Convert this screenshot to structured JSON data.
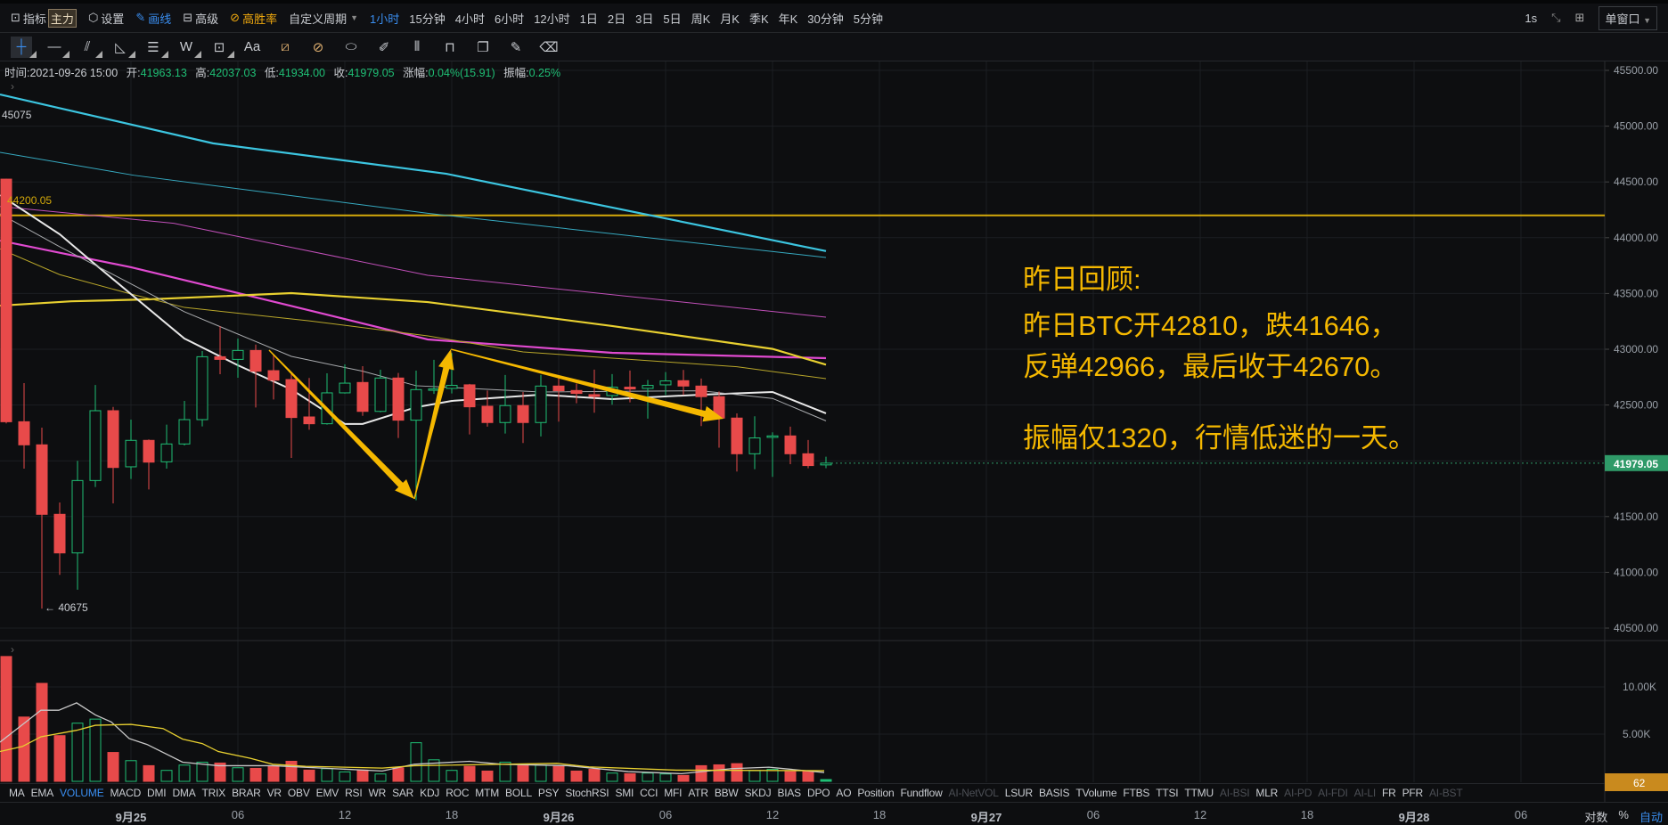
{
  "toolbar": {
    "indicator": "指标",
    "main_tag": "主力",
    "settings": "设置",
    "draw": "画线",
    "advanced": "高级",
    "winrate": "高胜率",
    "custom_period": "自定义周期",
    "periods": [
      "1小时",
      "15分钟",
      "4小时",
      "6小时",
      "12小时",
      "1日",
      "2日",
      "3日",
      "5日",
      "周K",
      "月K",
      "季K",
      "年K",
      "30分钟",
      "5分钟"
    ],
    "active_period": "1小时",
    "refresh": "1s",
    "layout": "单窗口"
  },
  "drawing_tools": [
    "crosshair",
    "horizontal-line",
    "trend-line",
    "triangle",
    "parallel-channel",
    "wave",
    "measure-box",
    "text",
    "fib-tool",
    "gann-tool",
    "ruler",
    "pen",
    "candle-pattern",
    "lock",
    "copy",
    "note",
    "delete"
  ],
  "info": {
    "time_label": "时间:",
    "time": "2021-09-26 15:00",
    "open_label": "开:",
    "open": "41963.13",
    "high_label": "高:",
    "high": "42037.03",
    "low_label": "低:",
    "low": "41934.00",
    "close_label": "收:",
    "close": "41979.05",
    "change_label": "涨幅:",
    "change": "0.04%(15.91)",
    "amp_label": "振幅:",
    "amp": "0.25%"
  },
  "annotation": {
    "title": "昨日回顾:",
    "line1": "昨日BTC开42810，跌41646，",
    "line2": "反弹42966，最后收于42670。",
    "line3": "振幅仅1320，行情低迷的一天。"
  },
  "labels": {
    "max": "45075",
    "min": "← 40675",
    "hline": "44200.05",
    "current_price": "41979.05",
    "volume_badge": "62"
  },
  "indicators": [
    {
      "name": "MA"
    },
    {
      "name": "EMA"
    },
    {
      "name": "VOLUME",
      "active": true
    },
    {
      "name": "MACD"
    },
    {
      "name": "DMI"
    },
    {
      "name": "DMA"
    },
    {
      "name": "TRIX"
    },
    {
      "name": "BRAR"
    },
    {
      "name": "VR"
    },
    {
      "name": "OBV"
    },
    {
      "name": "EMV"
    },
    {
      "name": "RSI"
    },
    {
      "name": "WR"
    },
    {
      "name": "SAR"
    },
    {
      "name": "KDJ"
    },
    {
      "name": "ROC"
    },
    {
      "name": "MTM"
    },
    {
      "name": "BOLL"
    },
    {
      "name": "PSY"
    },
    {
      "name": "StochRSI"
    },
    {
      "name": "SMI"
    },
    {
      "name": "CCI"
    },
    {
      "name": "MFI"
    },
    {
      "name": "ATR"
    },
    {
      "name": "BBW"
    },
    {
      "name": "SKDJ"
    },
    {
      "name": "BIAS"
    },
    {
      "name": "DPO"
    },
    {
      "name": "AO"
    },
    {
      "name": "Position"
    },
    {
      "name": "Fundflow"
    },
    {
      "name": "AI-NetVOL",
      "disabled": true
    },
    {
      "name": "LSUR"
    },
    {
      "name": "BASIS"
    },
    {
      "name": "TVolume"
    },
    {
      "name": "FTBS"
    },
    {
      "name": "TTSI"
    },
    {
      "name": "TTMU"
    },
    {
      "name": "AI-BSI",
      "disabled": true
    },
    {
      "name": "MLR"
    },
    {
      "name": "AI-PD",
      "disabled": true
    },
    {
      "name": "AI-FDI",
      "disabled": true
    },
    {
      "name": "AI-LI",
      "disabled": true
    },
    {
      "name": "FR"
    },
    {
      "name": "PFR"
    },
    {
      "name": "AI-BST",
      "disabled": true
    }
  ],
  "axis_controls": {
    "log": "对数",
    "percent": "%",
    "auto": "自动"
  },
  "chart_data": {
    "type": "candlestick",
    "interval": "1h",
    "colors": {
      "up": "#1fbf75",
      "down": "#e84a4a",
      "hline": "#d4a90a",
      "arrow": "#f5b800",
      "current": "#2f9a68",
      "badge": "#c98a1e"
    },
    "y_ticks": [
      45500,
      45000,
      44500,
      44000,
      43500,
      43000,
      42500,
      42000,
      41500,
      41000,
      40500
    ],
    "y_tick_labels": [
      "45500.00",
      "45000.00",
      "44500.00",
      "44000.00",
      "43500.00",
      "43000.00",
      "42500.00",
      "42000.00",
      "41500.00",
      "41000.00",
      "40500.00"
    ],
    "volume_ticks": [
      {
        "v": 10000,
        "label": "10.00K"
      },
      {
        "v": 5000,
        "label": "5.00K"
      }
    ],
    "x_ticks": [
      {
        "i": 7,
        "label": "9月25",
        "bold": true
      },
      {
        "i": 13,
        "label": "06"
      },
      {
        "i": 19,
        "label": "12"
      },
      {
        "i": 25,
        "label": "18"
      },
      {
        "i": 31,
        "label": "9月26",
        "bold": true
      },
      {
        "i": 37,
        "label": "06"
      },
      {
        "i": 43,
        "label": "12"
      },
      {
        "i": 49,
        "label": "18"
      },
      {
        "i": 55,
        "label": "9月27",
        "bold": true
      },
      {
        "i": 61,
        "label": "06"
      },
      {
        "i": 67,
        "label": "12"
      },
      {
        "i": 73,
        "label": "18"
      },
      {
        "i": 79,
        "label": "9月28",
        "bold": true
      },
      {
        "i": 85,
        "label": "06"
      }
    ],
    "candles_ohlc": [
      [
        44525,
        44530,
        42335,
        42350
      ],
      [
        42350,
        42696,
        41930,
        42143
      ],
      [
        42143,
        42297,
        40675,
        41520
      ],
      [
        41520,
        41626,
        40977,
        41174
      ],
      [
        41174,
        42000,
        40844,
        41823
      ],
      [
        41823,
        42680,
        41765,
        42449
      ],
      [
        42449,
        42483,
        41618,
        41940
      ],
      [
        41946,
        42369,
        41837,
        42183
      ],
      [
        42183,
        42191,
        41743,
        41988
      ],
      [
        41991,
        42324,
        41930,
        42151
      ],
      [
        42151,
        42537,
        42137,
        42369
      ],
      [
        42369,
        42984,
        42308,
        42933
      ],
      [
        42933,
        43207,
        42776,
        42909
      ],
      [
        42909,
        43096,
        42744,
        42989
      ],
      [
        42989,
        43042,
        42478,
        42803
      ],
      [
        42808,
        42957,
        42550,
        42723
      ],
      [
        42728,
        42776,
        42026,
        42388
      ],
      [
        42393,
        42742,
        42278,
        42332
      ],
      [
        42332,
        42784,
        42324,
        42609
      ],
      [
        42609,
        42864,
        42603,
        42696
      ],
      [
        42702,
        42848,
        42403,
        42443
      ],
      [
        42443,
        42816,
        42435,
        42742
      ],
      [
        42742,
        42787,
        42204,
        42364
      ],
      [
        42364,
        42808,
        41646,
        42638
      ],
      [
        42638,
        42905,
        42600,
        42644
      ],
      [
        42649,
        42966,
        42604,
        42676
      ],
      [
        42681,
        42689,
        42236,
        42484
      ],
      [
        42489,
        42630,
        42306,
        42343
      ],
      [
        42343,
        42769,
        42244,
        42495
      ],
      [
        42495,
        42617,
        42159,
        42343
      ],
      [
        42343,
        42769,
        42218,
        42670
      ],
      [
        42670,
        42750,
        42351,
        42628
      ],
      [
        42630,
        42692,
        42516,
        42604
      ],
      [
        42593,
        42817,
        42431,
        42577
      ],
      [
        42585,
        42777,
        42503,
        42660
      ],
      [
        42660,
        42809,
        42524,
        42644
      ],
      [
        42649,
        42724,
        42378,
        42676
      ],
      [
        42681,
        42795,
        42590,
        42716
      ],
      [
        42718,
        42814,
        42590,
        42670
      ],
      [
        42670,
        42737,
        42311,
        42575
      ],
      [
        42575,
        42622,
        42117,
        42383
      ],
      [
        42383,
        42425,
        41904,
        42063
      ],
      [
        42063,
        42399,
        41925,
        42205
      ],
      [
        42210,
        42255,
        41856,
        42223
      ],
      [
        42223,
        42306,
        41970,
        42063
      ],
      [
        42063,
        42186,
        41933,
        41957
      ],
      [
        41963,
        42037,
        41934,
        41979.05
      ]
    ],
    "volume": [
      13220,
      6810,
      10375,
      4840,
      6160,
      6590,
      3060,
      2190,
      1660,
      1160,
      1720,
      2030,
      1940,
      1440,
      1375,
      1590,
      2125,
      1190,
      1340,
      1000,
      1190,
      780,
      1440,
      4090,
      2280,
      1160,
      1590,
      1090,
      2030,
      1660,
      1720,
      1590,
      1090,
      1280,
      875,
      810,
      875,
      780,
      625,
      1660,
      1750,
      1875,
      1125,
      1280,
      1030,
      1125,
      190
    ],
    "hline": 44200.05,
    "ma_lines": [
      {
        "color": "#3cc5e0",
        "width": 2.2,
        "points": [
          [
            -0.35,
            45284
          ],
          [
            11.6,
            44846
          ],
          [
            24.7,
            44573
          ],
          [
            46,
            43880
          ]
        ]
      },
      {
        "color": "#36a9c0",
        "width": 1,
        "points": [
          [
            -0.35,
            44765
          ],
          [
            7.15,
            44560
          ],
          [
            23.65,
            44219
          ],
          [
            46,
            43823
          ]
        ]
      },
      {
        "color": "#c04fb8",
        "width": 1,
        "points": [
          [
            -0.35,
            44280
          ],
          [
            9.4,
            44129
          ],
          [
            23.65,
            43663
          ],
          [
            46,
            43288
          ]
        ]
      },
      {
        "color": "#e04ad0",
        "width": 2.2,
        "points": [
          [
            -0.35,
            43974
          ],
          [
            7,
            43735
          ],
          [
            16,
            43388
          ],
          [
            23.65,
            43088
          ],
          [
            34,
            42968
          ],
          [
            46,
            42920
          ]
        ]
      },
      {
        "color": "#e8d030",
        "width": 2.2,
        "points": [
          [
            -0.35,
            43391
          ],
          [
            3.65,
            43430
          ],
          [
            8,
            43447
          ],
          [
            16,
            43503
          ],
          [
            23.65,
            43423
          ],
          [
            34,
            43208
          ],
          [
            43,
            43003
          ],
          [
            46,
            42862
          ]
        ]
      },
      {
        "color": "#b8a62a",
        "width": 1,
        "points": [
          [
            -0.35,
            43900
          ],
          [
            3,
            43669
          ],
          [
            7,
            43495
          ],
          [
            10,
            43375
          ],
          [
            17,
            43255
          ],
          [
            23.65,
            43120
          ],
          [
            29,
            42976
          ],
          [
            41,
            42843
          ],
          [
            46,
            42736
          ]
        ]
      },
      {
        "color": "#e8e8e8",
        "width": 2,
        "points": [
          [
            -0.35,
            44382
          ],
          [
            3,
            44031
          ],
          [
            5,
            43760
          ],
          [
            10,
            43096
          ],
          [
            13,
            42856
          ],
          [
            16,
            42640
          ],
          [
            19,
            42330
          ],
          [
            20,
            42330
          ],
          [
            23,
            42480
          ],
          [
            25,
            42537
          ],
          [
            30,
            42593
          ],
          [
            34,
            42553
          ],
          [
            39,
            42593
          ],
          [
            43,
            42617
          ],
          [
            46,
            42425
          ]
        ]
      },
      {
        "color": "#a9abae",
        "width": 1,
        "points": [
          [
            -0.35,
            44214
          ],
          [
            3,
            43919
          ],
          [
            10,
            43336
          ],
          [
            16,
            42936
          ],
          [
            20,
            42803
          ],
          [
            23,
            42673
          ],
          [
            30,
            42617
          ],
          [
            39,
            42628
          ],
          [
            43,
            42559
          ],
          [
            46,
            42358
          ]
        ]
      }
    ],
    "volume_ma_lines": [
      {
        "color": "#c8c8c8",
        "points": [
          [
            -0.35,
            4156
          ],
          [
            1.95,
            7531
          ],
          [
            2.95,
            7531
          ],
          [
            3.95,
            8312
          ],
          [
            5,
            7031
          ],
          [
            5.9,
            6281
          ],
          [
            6.9,
            4531
          ],
          [
            7.9,
            3906
          ],
          [
            9.9,
            2031
          ],
          [
            11.9,
            1656
          ],
          [
            14.95,
            1656
          ],
          [
            21.1,
            1094
          ],
          [
            22.9,
            1812
          ],
          [
            26,
            2125
          ],
          [
            27.8,
            1812
          ],
          [
            31.5,
            1656
          ],
          [
            34.9,
            1031
          ],
          [
            37.9,
            812
          ],
          [
            40.7,
            1344
          ],
          [
            42.8,
            1500
          ],
          [
            45.9,
            937
          ]
        ]
      },
      {
        "color": "#e8d030",
        "points": [
          [
            -0.35,
            3156
          ],
          [
            0.9,
            3687
          ],
          [
            1.95,
            4719
          ],
          [
            3.95,
            5406
          ],
          [
            5,
            5937
          ],
          [
            7,
            6031
          ],
          [
            8.8,
            5594
          ],
          [
            9.9,
            4469
          ],
          [
            11,
            4000
          ],
          [
            11.9,
            3156
          ],
          [
            13.7,
            2437
          ],
          [
            14.95,
            1812
          ],
          [
            16.8,
            1594
          ],
          [
            21.1,
            1406
          ],
          [
            22.9,
            1656
          ],
          [
            30.9,
            1906
          ],
          [
            32.7,
            1531
          ],
          [
            37.6,
            1187
          ],
          [
            45.9,
            1125
          ]
        ]
      }
    ],
    "arrows": [
      {
        "from": [
          14.75,
          42992
        ],
        "to": [
          22.9,
          41658
        ]
      },
      {
        "from": [
          22.9,
          41658
        ],
        "to": [
          24.95,
          43000
        ]
      },
      {
        "from": [
          24.95,
          43000
        ],
        "to": [
          40.25,
          42377
        ]
      }
    ]
  }
}
